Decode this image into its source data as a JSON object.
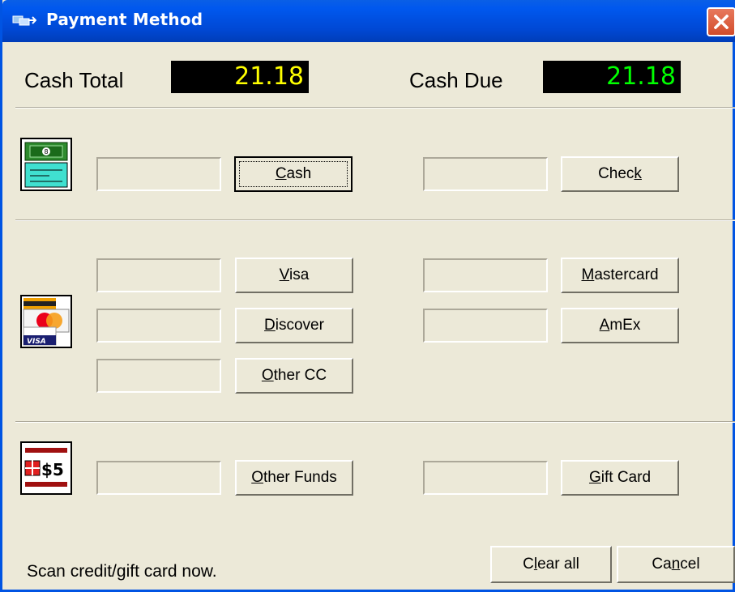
{
  "window": {
    "title": "Payment Method"
  },
  "totals": {
    "cash_total_label": "Cash Total",
    "cash_total_value": "21.18",
    "cash_due_label": "Cash Due",
    "cash_due_value": "21.18"
  },
  "buttons": {
    "cash": {
      "pre": "",
      "key": "C",
      "post": "ash"
    },
    "check": {
      "pre": "Chec",
      "key": "k",
      "post": ""
    },
    "visa": {
      "pre": "",
      "key": "V",
      "post": "isa"
    },
    "mastercard": {
      "pre": "",
      "key": "M",
      "post": "astercard"
    },
    "discover": {
      "pre": "",
      "key": "D",
      "post": "iscover"
    },
    "amex": {
      "pre": "",
      "key": "A",
      "post": "mEx"
    },
    "other_cc": {
      "pre": "",
      "key": "O",
      "post": "ther CC"
    },
    "other_funds": {
      "pre": "",
      "key": "O",
      "post": "ther Funds"
    },
    "gift_card": {
      "pre": "",
      "key": "G",
      "post": "ift Card"
    },
    "clear_all": {
      "pre": "C",
      "key": "l",
      "post": "ear all"
    },
    "cancel": {
      "pre": "Ca",
      "key": "n",
      "post": "cel"
    }
  },
  "icons": {
    "cash_check": "cash-check-icon",
    "credit_cards": "credit-cards-icon",
    "gift_funds": "gift-funds-icon",
    "gift_funds_text": "$5"
  },
  "status": {
    "message": "Scan credit/gift card now."
  },
  "colors": {
    "cash_total_digits": "#ffff00",
    "cash_due_digits": "#00ff00",
    "title_bar": "#0054e3",
    "dialog_bg": "#ece9d8"
  }
}
